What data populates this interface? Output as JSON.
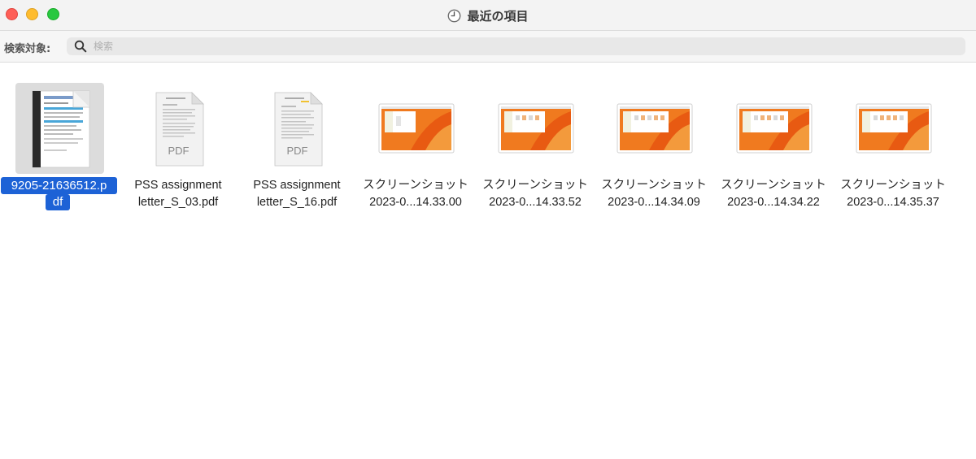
{
  "window": {
    "title": "最近の項目",
    "clock_icon": "clock-icon",
    "traffic_lights": {
      "close": "#fe5f57",
      "minimize": "#febc2e",
      "maximize": "#28c840"
    }
  },
  "search": {
    "scope_label": "検索対象:",
    "placeholder": "検索",
    "value": "",
    "icon": "search-icon"
  },
  "files": [
    {
      "name_line1": "9205-21636512.p",
      "name_line2": "df",
      "kind": "pdf-scan",
      "selected": true
    },
    {
      "name_line1": "PSS assignment",
      "name_line2": "letter_S_03.pdf",
      "kind": "pdf",
      "badge": "PDF"
    },
    {
      "name_line1": "PSS assignment",
      "name_line2": "letter_S_16.pdf",
      "kind": "pdf",
      "badge": "PDF"
    },
    {
      "name_line1": "スクリーンショット",
      "name_line2": "2023-0...14.33.00",
      "kind": "screenshot"
    },
    {
      "name_line1": "スクリーンショット",
      "name_line2": "2023-0...14.33.52",
      "kind": "screenshot"
    },
    {
      "name_line1": "スクリーンショット",
      "name_line2": "2023-0...14.34.09",
      "kind": "screenshot"
    },
    {
      "name_line1": "スクリーンショット",
      "name_line2": "2023-0...14.34.22",
      "kind": "screenshot"
    },
    {
      "name_line1": "スクリーンショット",
      "name_line2": "2023-0...14.35.37",
      "kind": "screenshot"
    }
  ],
  "colors": {
    "selection": "#1d62d6",
    "wallpaper_orange": "#f07a1f"
  }
}
